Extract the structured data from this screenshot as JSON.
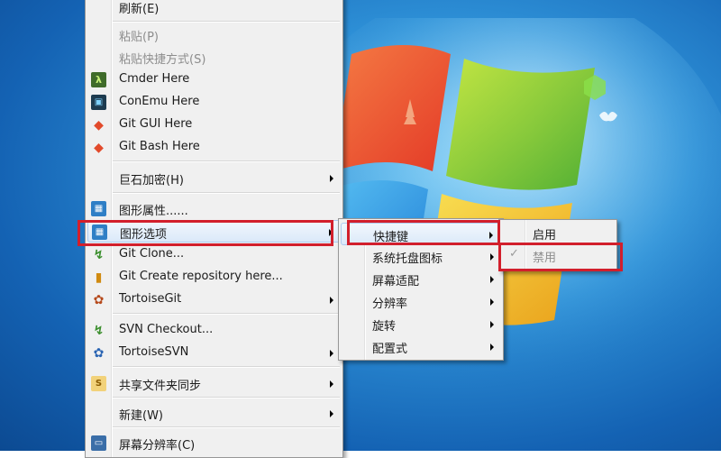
{
  "context_menu": {
    "items": [
      {
        "label": "刷新(E)",
        "disabled": false
      },
      {
        "label": "粘贴(P)",
        "disabled": true
      },
      {
        "label": "粘贴快捷方式(S)",
        "disabled": true
      },
      {
        "label": "Cmder Here",
        "icon": "cmder-icon"
      },
      {
        "label": "ConEmu Here",
        "icon": "conemu-icon"
      },
      {
        "label": "Git GUI Here",
        "icon": "git-gui-icon"
      },
      {
        "label": "Git Bash Here",
        "icon": "git-bash-icon"
      },
      {
        "label": "巨石加密(H)"
      },
      {
        "label": "图形属性......",
        "icon": "intel-graphics-icon"
      },
      {
        "label": "图形选项",
        "icon": "intel-graphics-icon"
      },
      {
        "label": "Git Clone...",
        "icon": "git-clone-icon"
      },
      {
        "label": "Git Create repository here...",
        "icon": "git-create-repo-icon"
      },
      {
        "label": "TortoiseGit",
        "icon": "tortoisegit-icon"
      },
      {
        "label": "SVN Checkout...",
        "icon": "svn-checkout-icon"
      },
      {
        "label": "TortoiseSVN",
        "icon": "tortoisesvn-icon"
      },
      {
        "label": "共享文件夹同步",
        "icon": "share-sync-icon"
      },
      {
        "label": "新建(W)"
      },
      {
        "label": "屏幕分辨率(C)",
        "icon": "screen-resolution-icon"
      }
    ]
  },
  "graphics_submenu": {
    "items": [
      {
        "label": "快捷键"
      },
      {
        "label": "系统托盘图标"
      },
      {
        "label": "屏幕适配"
      },
      {
        "label": "分辨率"
      },
      {
        "label": "旋转"
      },
      {
        "label": "配置式"
      }
    ]
  },
  "hotkey_submenu": {
    "items": [
      {
        "label": "启用"
      },
      {
        "label": "禁用",
        "checked": true
      }
    ]
  },
  "colors": {
    "highlight_box": "#d21f2c",
    "desktop": "#1e74c6"
  }
}
